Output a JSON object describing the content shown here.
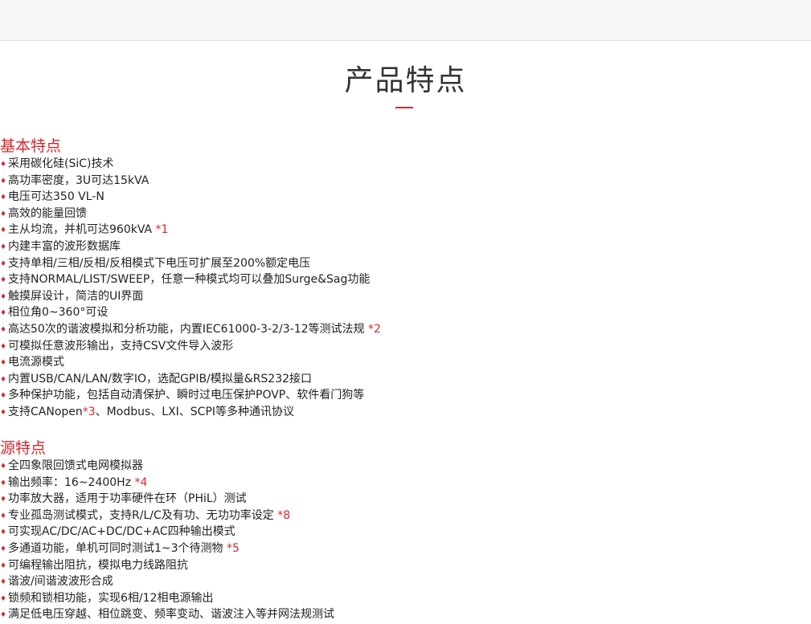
{
  "page": {
    "title": "产品特点"
  },
  "sections": [
    {
      "heading": "基本特点",
      "items": [
        {
          "text": "采用碳化硅(SiC)技术",
          "note": ""
        },
        {
          "text": "高功率密度，3U可达15kVA",
          "note": ""
        },
        {
          "text": "电压可达350 VL-N",
          "note": ""
        },
        {
          "text": "高效的能量回馈",
          "note": ""
        },
        {
          "text": "主从均流，并机可达960kVA ",
          "note": "*1"
        },
        {
          "text": "内建丰富的波形数据库",
          "note": ""
        },
        {
          "text": "支持单相/三相/反相/反相模式下电压可扩展至200%额定电压",
          "note": ""
        },
        {
          "text": "支持NORMAL/LIST/SWEEP，任意一种模式均可以叠加Surge&Sag功能",
          "note": ""
        },
        {
          "text": "触摸屏设计，简洁的UI界面",
          "note": ""
        },
        {
          "text": "相位角0~360°可设",
          "note": ""
        },
        {
          "text": "高达50次的谐波模拟和分析功能，内置IEC61000-3-2/3-12等测试法规 ",
          "note": "*2"
        },
        {
          "text": "可模拟任意波形输出，支持CSV文件导入波形",
          "note": ""
        },
        {
          "text": "电流源模式",
          "note": ""
        },
        {
          "text": "内置USB/CAN/LAN/数字IO，选配GPIB/模拟量&RS232接口",
          "note": ""
        },
        {
          "text": "多种保护功能，包括自动清保护、瞬时过电压保护POVP、软件看门狗等",
          "note": ""
        },
        {
          "text": "支持CANopen",
          "note": "*3",
          "suffix": "、Modbus、LXI、SCPI等多种通讯协议"
        }
      ]
    },
    {
      "heading": "源特点",
      "items": [
        {
          "text": "全四象限回馈式电网模拟器",
          "note": ""
        },
        {
          "text": "输出频率：16~2400Hz ",
          "note": "*4"
        },
        {
          "text": "功率放大器，适用于功率硬件在环（PHiL）测试",
          "note": ""
        },
        {
          "text": "专业孤岛测试模式，支持R/L/C及有功、无功功率设定 ",
          "note": "*8"
        },
        {
          "text": "可实现AC/DC/AC+DC/DC+AC四种输出模式",
          "note": ""
        },
        {
          "text": "多通道功能，单机可同时测试1~3个待测物 ",
          "note": "*5"
        },
        {
          "text": "可编程输出阻抗，模拟电力线路阻抗",
          "note": ""
        },
        {
          "text": "谐波/间谐波波形合成",
          "note": ""
        },
        {
          "text": "锁频和锁相功能，实现6相/12相电源输出",
          "note": ""
        },
        {
          "text": "满足低电压穿越、相位跳变、频率变动、谐波注入等并网法规测试",
          "note": ""
        }
      ]
    }
  ],
  "colors": {
    "accent": "#d9272e",
    "text": "#222222",
    "topbar": "#f6f6f6"
  },
  "icons": {
    "bullet": "diamond-bullet-icon",
    "bullet_glyph": "♦"
  }
}
